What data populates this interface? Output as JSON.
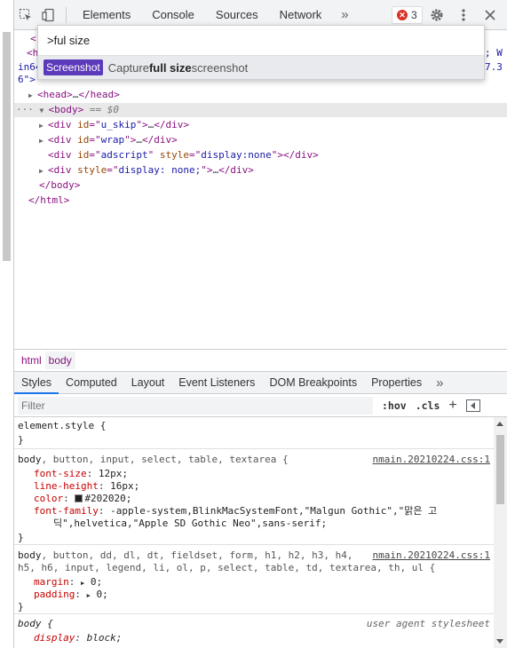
{
  "toolbar": {
    "tabs": [
      "Elements",
      "Console",
      "Sources",
      "Network"
    ],
    "more": "»",
    "error_count": "3"
  },
  "command_menu": {
    "input_value": ">ful size",
    "result_badge": "Screenshot",
    "result_prefix": "Capture ",
    "result_bold": "full size",
    "result_suffix": " screenshot"
  },
  "dom": {
    "peek_top": "<",
    "peek_html": "<h",
    "peek_right1": "; W",
    "peek_in": "in64",
    "peek_right2": "7.3",
    "peek_6": "6\">",
    "head_open": "<head>",
    "head_ellipsis": "…",
    "head_close": "</head>",
    "body_dots": "···",
    "body_open": "<body>",
    "body_eq": " == $0",
    "div1_id": "u_skip",
    "div2_id": "wrap",
    "div3_id": "adscript",
    "div3_style": "display:none",
    "div4_style": "display: none;",
    "body_close": "</body>",
    "html_close": "</html>"
  },
  "breadcrumbs": [
    "html",
    "body"
  ],
  "style_tabs": [
    "Styles",
    "Computed",
    "Layout",
    "Event Listeners",
    "DOM Breakpoints",
    "Properties"
  ],
  "style_more": "»",
  "filter": {
    "placeholder": "Filter",
    "hov": ":hov",
    "cls": ".cls",
    "plus": "+"
  },
  "rules": {
    "element_style": "element.style {",
    "close": "}",
    "r1_selector_a": "body",
    "r1_selector_b": ", button, input, select, table, textarea {",
    "r1_source": "nmain.20210224.css:1",
    "r1_p1": "font-size",
    "r1_v1": "12px;",
    "r1_p2": "line-height",
    "r1_v2": "16px;",
    "r1_p3": "color",
    "r1_v3": "#202020;",
    "r1_p4": "font-family",
    "r1_v4a": "-apple-system,BlinkMacSystemFont,\"Malgun Gothic\",\"맑은 고",
    "r1_v4b": "딕\",helvetica,\"Apple SD Gothic Neo\",sans-serif;",
    "r2_selector_a": "body",
    "r2_selector_b": ", button, dd, dl, dt, fieldset, form, h1, h2, h3, h4,",
    "r2_selector_c": "h5, h6, input, legend, li, ol, p, select, table, td, textarea, th, ul {",
    "r2_source": "nmain.20210224.css:1",
    "r2_p1": "margin",
    "r2_v1": "0;",
    "r2_p2": "padding",
    "r2_v2": "0;",
    "r3_selector": "body {",
    "r3_source": "user agent stylesheet",
    "r3_p1": "display",
    "r3_v1": "block;"
  }
}
